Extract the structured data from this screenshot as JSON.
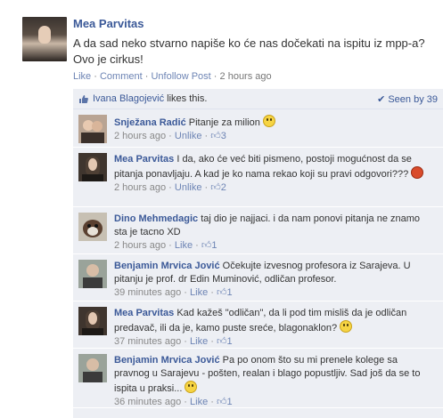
{
  "post": {
    "author": "Mea Parvitas",
    "text": "A da sad neko stvarno napiše ko će nas dočekati na ispitu iz mpp-a? Ovo je cirkus!",
    "actions": {
      "like": "Like",
      "comment": "Comment",
      "unfollow": "Unfollow Post",
      "time": "2 hours ago"
    }
  },
  "likes": {
    "name": "Ivana Blagojević",
    "suffix": "likes this.",
    "seen": "Seen by 39"
  },
  "comments": [
    {
      "author": "Snježana Radić",
      "text": "Pitanje za milion",
      "time": "2 hours ago",
      "action": "Unlike",
      "likes": "3"
    },
    {
      "author": "Mea Parvitas",
      "text": "I da, ako će već biti pismeno, postoji mogućnost da se pitanja ponavljaju. A kad je ko nama rekao koji su pravi odgovori???",
      "time": "2 hours ago",
      "action": "Unlike",
      "likes": "2"
    },
    {
      "author": "Dino Mehmedagic",
      "text": "taj dio je najjaci. i da nam ponovi pitanja ne znamo sta je tacno XD",
      "time": "2 hours ago",
      "action": "Like",
      "likes": "1"
    },
    {
      "author": "Benjamin Mrvica Jović",
      "text": "Očekujte izvesnog profesora iz Sarajeva. U pitanju je prof. dr Edin Muminović, odličan profesor.",
      "time": "39 minutes ago",
      "action": "Like",
      "likes": "1"
    },
    {
      "author": "Mea Parvitas",
      "text": "Kad kažeš \"odličan\", da li pod tim misliš da je odličan predavač, ili da je, kamo puste sreće, blagonaklon?",
      "time": "37 minutes ago",
      "action": "Like",
      "likes": "1"
    },
    {
      "author": "Benjamin Mrvica Jović",
      "text": "Pa po onom što su mi prenele kolege sa pravnog u Sarajevu - pošten, realan i blago popustljiv. Sad još da se to ispita u praksi...",
      "time": "36 minutes ago",
      "action": "Like",
      "likes": "1"
    }
  ],
  "meta_sep": "·",
  "like_icon": "thumbs-up-icon"
}
